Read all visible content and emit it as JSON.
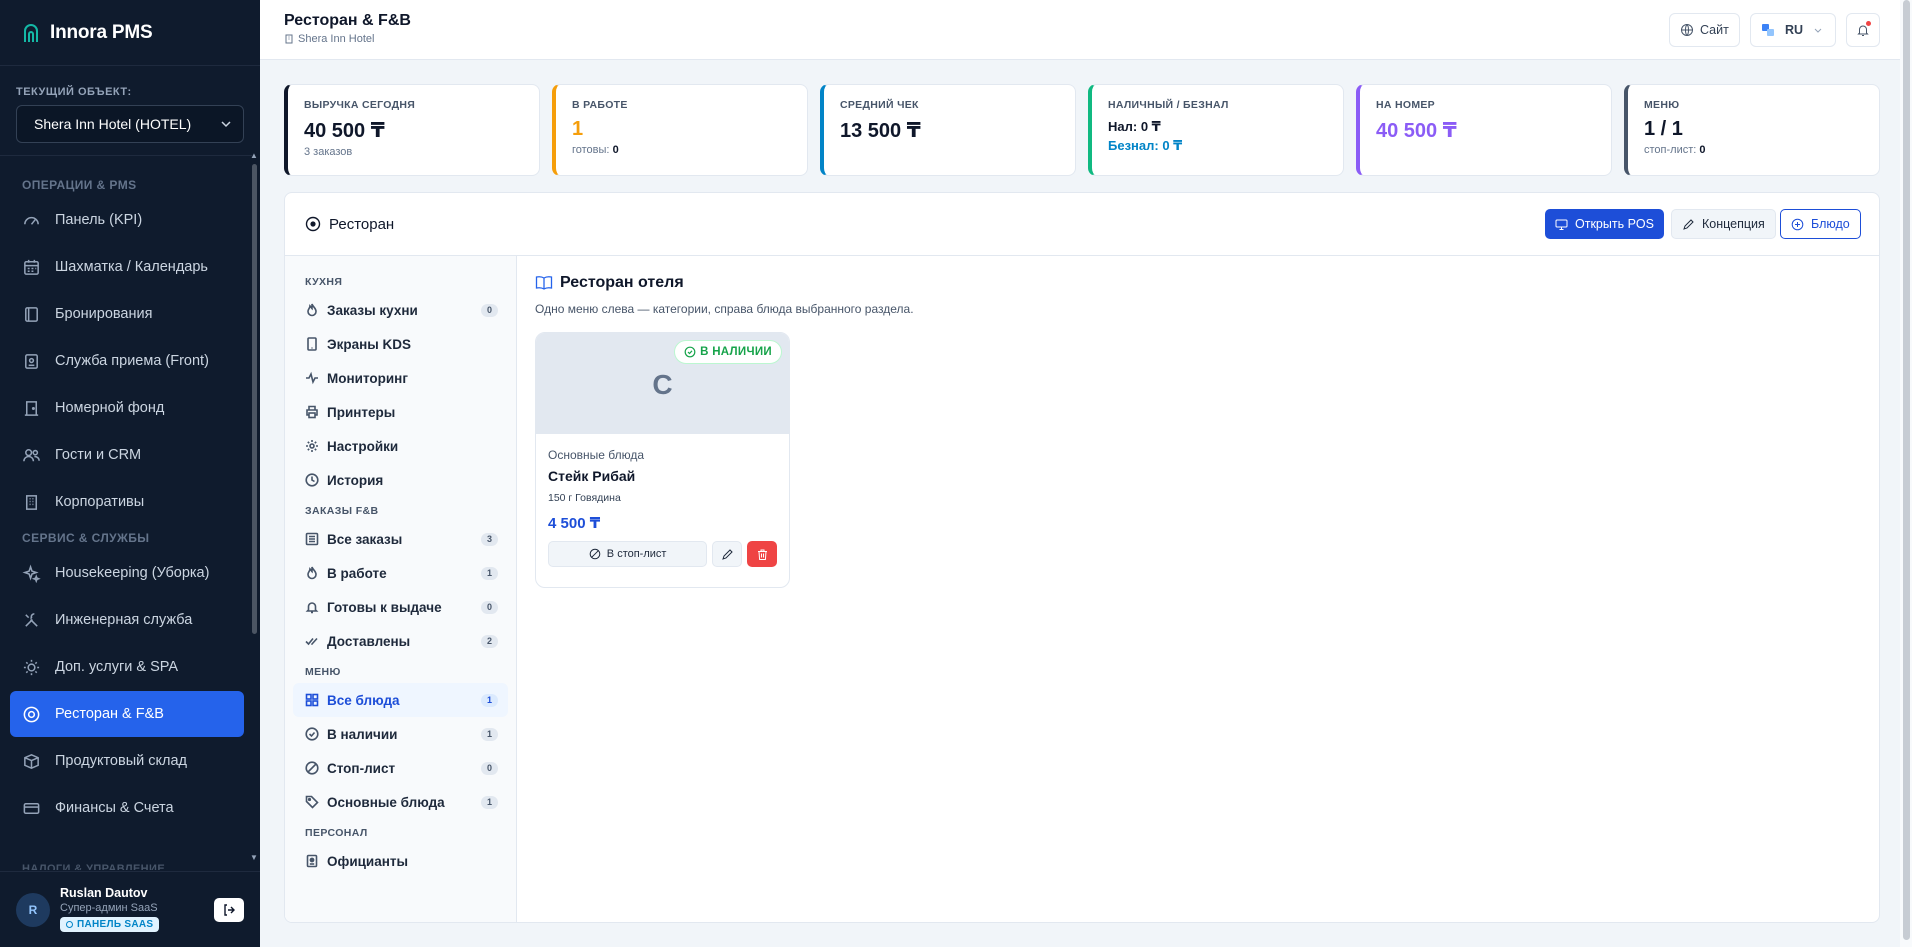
{
  "app": {
    "name": "Innora PMS"
  },
  "sidebar": {
    "object_label": "ТЕКУЩИЙ ОБЪЕКТ:",
    "object_value": "Shera Inn Hotel (HOTEL)",
    "sections": [
      {
        "title": "ОПЕРАЦИИ & PMS",
        "items": [
          {
            "label": "Панель (KPI)",
            "icon": "gauge-icon"
          },
          {
            "label": "Шахматка / Календарь",
            "icon": "calendar-icon"
          },
          {
            "label": "Бронирования",
            "icon": "book-icon"
          },
          {
            "label": "Служба приема (Front)",
            "icon": "id-card-icon"
          },
          {
            "label": "Номерной фонд",
            "icon": "door-icon"
          },
          {
            "label": "Гости и CRM",
            "icon": "users-icon"
          },
          {
            "label": "Корпоративы",
            "icon": "building-icon"
          }
        ]
      },
      {
        "title": "СЕРВИС & СЛУЖБЫ",
        "items": [
          {
            "label": "Housekeeping (Уборка)",
            "icon": "sparkles-icon"
          },
          {
            "label": "Инженерная служба",
            "icon": "tools-icon"
          },
          {
            "label": "Доп. услуги & SPA",
            "icon": "sun-icon"
          },
          {
            "label": "Ресторан & F&B",
            "icon": "restaurant-icon",
            "active": true
          },
          {
            "label": "Продуктовый склад",
            "icon": "box-icon"
          },
          {
            "label": "Финансы & Счета",
            "icon": "card-icon"
          }
        ]
      }
    ],
    "cut_section": "НАЛОГИ & УПРАВЛЕНИЕ",
    "user": {
      "initial": "R",
      "name": "Ruslan Dautov",
      "role": "Супер-админ SaaS",
      "badge": "ПАНЕЛЬ SAAS"
    }
  },
  "header": {
    "title": "Ресторан & F&B",
    "subtitle": "Shera Inn Hotel",
    "site_label": "Сайт",
    "lang": "RU"
  },
  "stats": [
    {
      "label": "ВЫРУЧКА СЕГОДНЯ",
      "value": "40 500 ₸",
      "sub": "3 заказов",
      "color": "#0f172a"
    },
    {
      "label": "В РАБОТЕ",
      "value": "1",
      "sub_label": "готовы:",
      "sub_value": "0",
      "color": "#f59e0b"
    },
    {
      "label": "СРЕДНИЙ ЧЕК",
      "value": "13 500 ₸",
      "color": "#0284c7"
    },
    {
      "label": "НАЛИЧНЫЙ / БЕЗНАЛ",
      "line1": "Нал: 0 ₸",
      "line2": "Безнал: 0 ₸",
      "color": "#10b981"
    },
    {
      "label": "НА НОМЕР",
      "value": "40 500 ₸",
      "color": "#8b5cf6"
    },
    {
      "label": "МЕНЮ",
      "value": "1 / 1",
      "sub_label": "стоп-лист:",
      "sub_value": "0",
      "color": "#475569"
    }
  ],
  "panel": {
    "title": "Ресторан",
    "btn_pos": "Открыть POS",
    "btn_concept": "Концепция",
    "btn_dish": "Блюдо",
    "menu": [
      {
        "title": "КУХНЯ",
        "items": [
          {
            "label": "Заказы кухни",
            "count": "0",
            "icon": "fire-icon"
          },
          {
            "label": "Экраны KDS",
            "icon": "tablet-icon"
          },
          {
            "label": "Мониторинг",
            "icon": "activity-icon"
          },
          {
            "label": "Принтеры",
            "icon": "printer-icon"
          },
          {
            "label": "Настройки",
            "icon": "gear-icon"
          },
          {
            "label": "История",
            "icon": "clock-icon"
          }
        ]
      },
      {
        "title": "ЗАКАЗЫ F&B",
        "items": [
          {
            "label": "Все заказы",
            "count": "3",
            "icon": "list-icon"
          },
          {
            "label": "В работе",
            "count": "1",
            "icon": "fire-icon"
          },
          {
            "label": "Готовы к выдаче",
            "count": "0",
            "icon": "bell-icon"
          },
          {
            "label": "Доставлены",
            "count": "2",
            "icon": "double-check-icon"
          }
        ]
      },
      {
        "title": "МЕНЮ",
        "items": [
          {
            "label": "Все блюда",
            "count": "1",
            "icon": "grid-icon",
            "active": true
          },
          {
            "label": "В наличии",
            "count": "1",
            "icon": "check-circle-icon"
          },
          {
            "label": "Стоп-лист",
            "count": "0",
            "icon": "ban-icon"
          },
          {
            "label": "Основные блюда",
            "count": "1",
            "icon": "tag-icon"
          }
        ]
      },
      {
        "title": "ПЕРСОНАЛ",
        "items": [
          {
            "label": "Официанты",
            "icon": "badge-icon"
          }
        ]
      }
    ],
    "content": {
      "title": "Ресторан отеля",
      "desc": "Одно меню слева — категории, справа блюда выбранного раздела.",
      "dish": {
        "letter": "С",
        "badge": "В НАЛИЧИИ",
        "category": "Основные блюда",
        "name": "Стейк Рибай",
        "meta": "150 г Говядина",
        "price": "4 500 ₸",
        "stop_label": "В стоп-лист"
      }
    }
  }
}
